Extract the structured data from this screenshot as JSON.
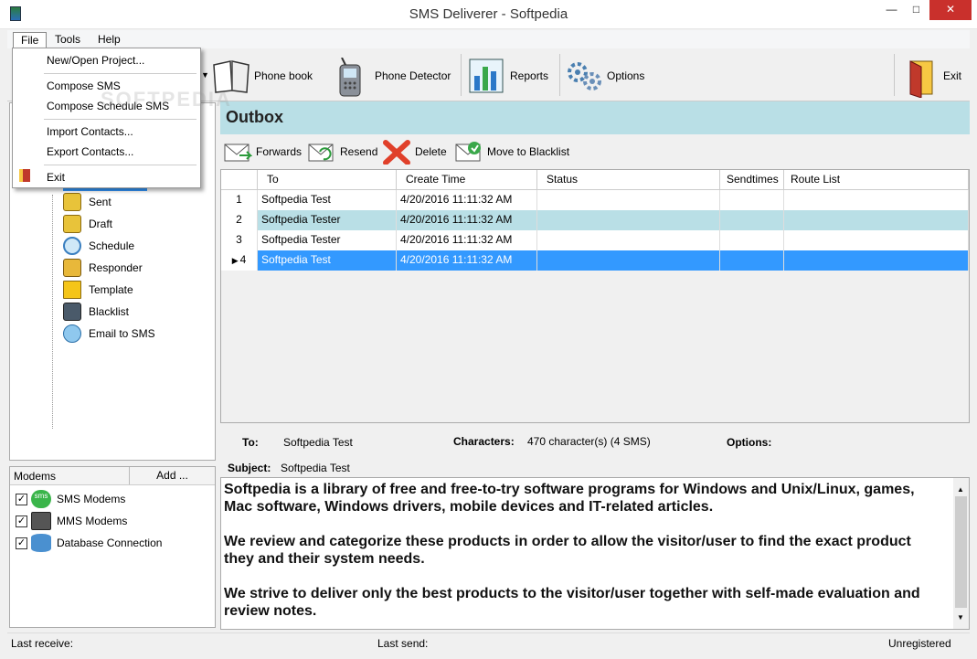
{
  "window": {
    "title": "SMS Deliverer - Softpedia"
  },
  "menubar": {
    "file": "File",
    "tools": "Tools",
    "help": "Help"
  },
  "file_menu": {
    "items": [
      "New/Open Project...",
      "Compose SMS",
      "Compose Schedule SMS",
      "Import Contacts...",
      "Export Contacts...",
      "Exit"
    ]
  },
  "toolbar": {
    "phone_book": "Phone book",
    "phone_detector": "Phone Detector",
    "reports": "Reports",
    "options": "Options",
    "exit": "Exit"
  },
  "watermark": "SOFTPEDIA",
  "tree": {
    "items": [
      "Sent",
      "Draft",
      "Schedule",
      "Responder",
      "Template",
      "Blacklist",
      "Email to SMS"
    ]
  },
  "modems": {
    "header": "Modems",
    "add": "Add ...",
    "items": [
      "SMS Modems",
      "MMS Modems",
      "Database Connection"
    ],
    "sms_badge": "sms"
  },
  "outbox": {
    "title": "Outbox",
    "actions": {
      "forwards": "Forwards",
      "resend": "Resend",
      "delete": "Delete",
      "blacklist": "Move to Blacklist"
    },
    "columns": [
      "To",
      "Create Time",
      "Status",
      "Sendtimes",
      "Route List"
    ],
    "rows": [
      {
        "num": "1",
        "to": "Softpedia Test",
        "time": "4/20/2016 11:11:32 AM",
        "status": "",
        "sendtimes": "",
        "route": ""
      },
      {
        "num": "2",
        "to": "Softpedia Tester",
        "time": "4/20/2016 11:11:32 AM",
        "status": "",
        "sendtimes": "",
        "route": ""
      },
      {
        "num": "3",
        "to": "Softpedia Tester",
        "time": "4/20/2016 11:11:32 AM",
        "status": "",
        "sendtimes": "",
        "route": ""
      },
      {
        "num": "4",
        "to": "Softpedia Test",
        "time": "4/20/2016 11:11:32 AM",
        "status": "",
        "sendtimes": "",
        "route": ""
      }
    ],
    "current_row_marker": "▶"
  },
  "details": {
    "to_label": "To:",
    "to_value": "Softpedia Test",
    "chars_label": "Characters:",
    "chars_value": "470 character(s) (4 SMS)",
    "options_label": "Options:",
    "subject_label": "Subject:",
    "subject_value": "Softpedia Test"
  },
  "message": {
    "paragraphs": [
      "Softpedia is a library of free and free-to-try software programs for Windows and Unix/Linux, games, Mac software, Windows drivers, mobile devices and IT-related articles.",
      "We review and categorize these products in order to allow the visitor/user to find the exact product they and their system needs.",
      "We strive to deliver only the best products to the visitor/user together with self-made evaluation and review notes."
    ]
  },
  "status": {
    "last_receive": "Last receive:",
    "last_send": "Last send:",
    "registration": "Unregistered"
  },
  "colors": {
    "selected_row": "#3399ff",
    "alt_row": "#b9dfe6",
    "header_band": "#b9dfe6",
    "close_button": "#c9302c"
  }
}
